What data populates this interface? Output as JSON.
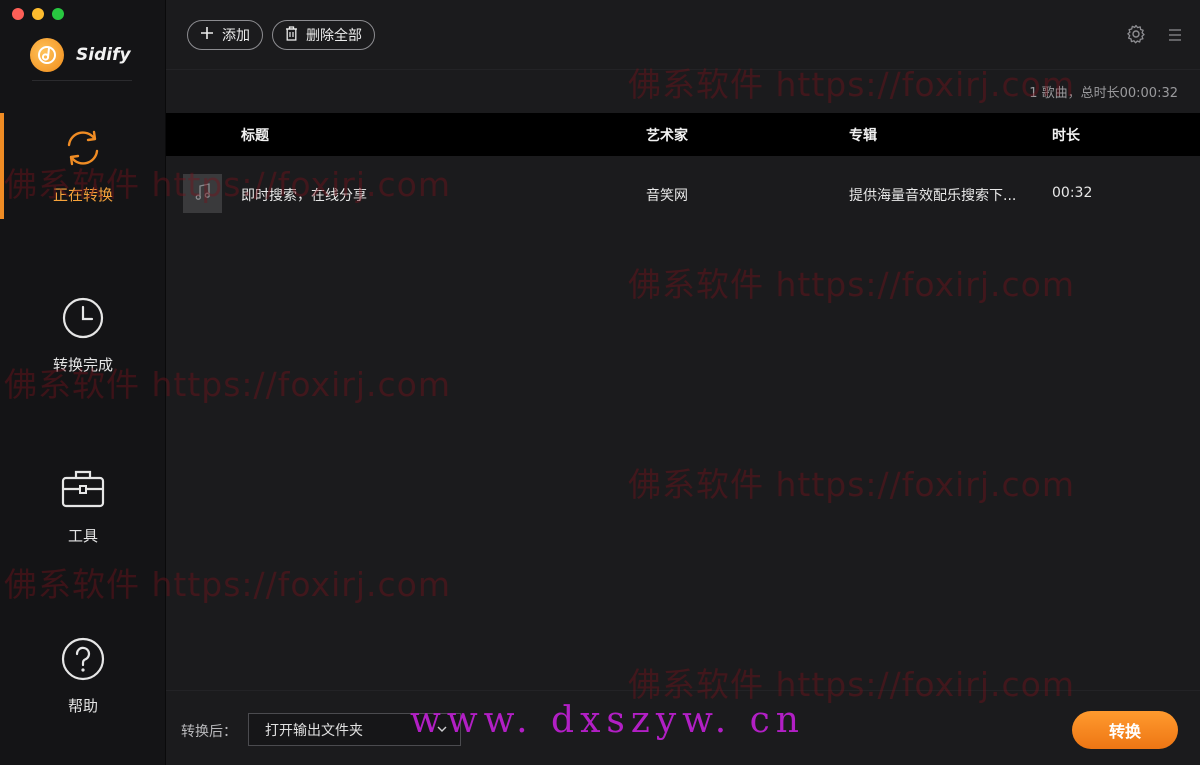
{
  "app": {
    "name": "Sidify"
  },
  "sidebar": {
    "items": [
      {
        "label": "正在转换",
        "icon": "converting-icon",
        "active": true
      },
      {
        "label": "转换完成",
        "icon": "clock-icon",
        "active": false
      },
      {
        "label": "工具",
        "icon": "toolbox-icon",
        "active": false
      },
      {
        "label": "帮助",
        "icon": "help-icon",
        "active": false
      }
    ]
  },
  "toolbar": {
    "add_label": "添加",
    "delete_all_label": "删除全部",
    "icons": [
      "gear-icon",
      "menu-icon"
    ]
  },
  "summary": "1 歌曲，总时长00:00:32",
  "table": {
    "columns": [
      "标题",
      "艺术家",
      "专辑",
      "时长"
    ],
    "rows": [
      {
        "title": "即时搜索，在线分享",
        "artist": "音笑网",
        "album": "提供海量音效配乐搜索下...",
        "duration": "00:32"
      }
    ]
  },
  "bottom": {
    "after_label": "转换后：",
    "after_option": "打开输出文件夹",
    "convert_label": "转换"
  },
  "watermark": {
    "text": "佛系软件 https://foxirj.com",
    "site": "www. dxszyw. cn"
  },
  "colors": {
    "accent": "#f08c24",
    "background": "#1b1b1d",
    "sidebar": "#141416",
    "table_header": "#000000"
  }
}
